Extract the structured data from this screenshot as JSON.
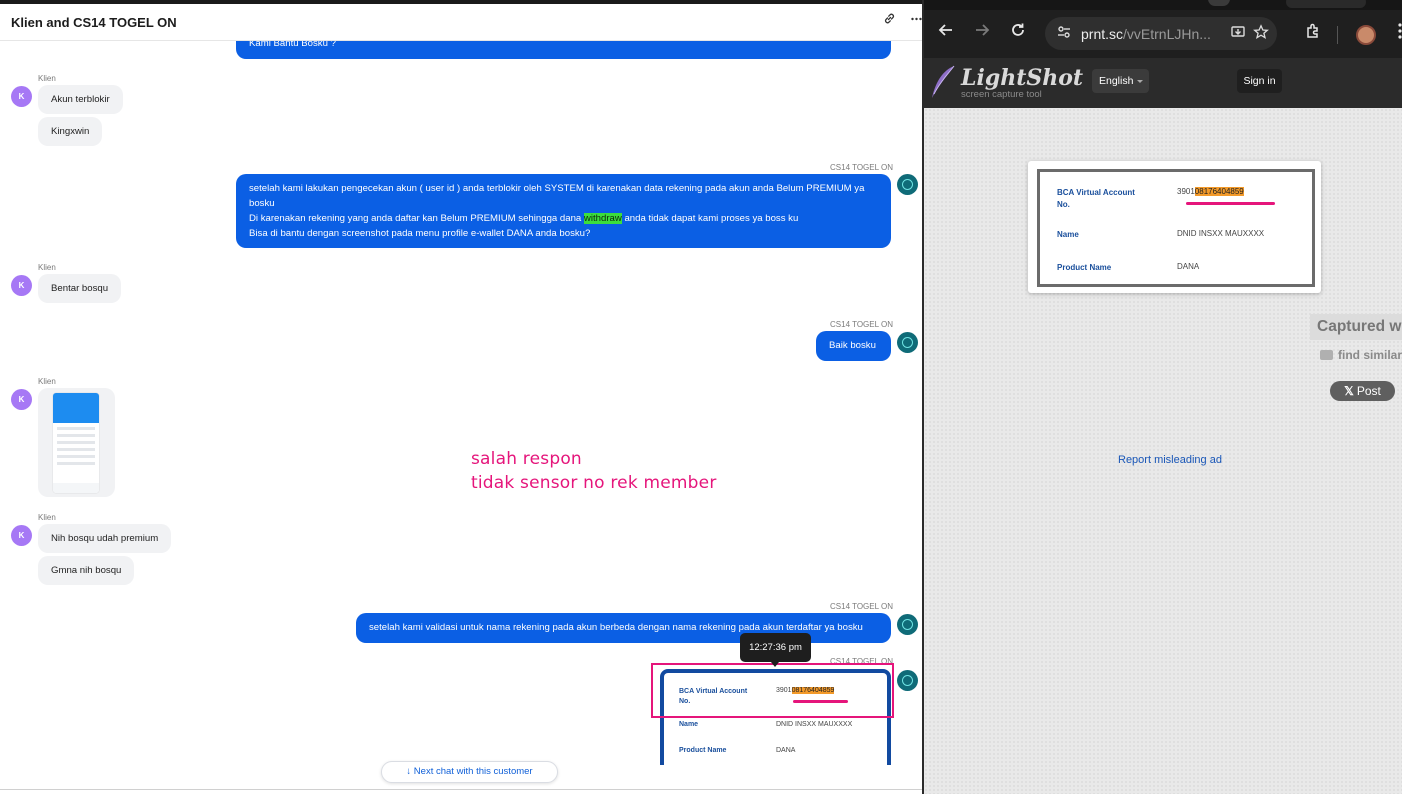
{
  "chat": {
    "title": "Klien and CS14 TOGEL ON",
    "top_bubble": "Kami Bantu Bosku ?",
    "client_name": "Klien",
    "client_initial": "K",
    "agent_name": "CS14 TOGEL ON",
    "msg_akun_terblokir": "Akun terblokir",
    "msg_kingxwin": "Kingxwin",
    "agent_msg1": {
      "line1": "setelah kami lakukan pengecekan akun ( user id ) anda terblokir oleh SYSTEM di karenakan data rekening pada akun anda Belum PREMIUM ya",
      "line2": "bosku",
      "line3a": "Di karenakan rekening yang anda daftar kan Belum PREMIUM sehingga dana ",
      "line3_highlight": "withdraw",
      "line3b": " anda tidak dapat kami proses ya boss ku",
      "line4": "Bisa di bantu dengan screenshot pada menu profile e-wallet DANA anda bosku?"
    },
    "msg_bentar": "Bentar bosqu",
    "agent_msg2": "Baik bosku",
    "msg_premium": "Nih bosqu udah premium",
    "msg_gmna": "Gmna nih bosqu",
    "agent_msg3": "setelah kami validasi untuk nama rekening pada akun berbeda dengan nama rekening pada akun terdaftar ya bosku",
    "tooltip_time": "12:27:36 pm",
    "annotation_line1": "salah respon",
    "annotation_line2": "tidak sensor no rek member",
    "card": {
      "va_label_1": "BCA Virtual Account",
      "va_label_2": "No.",
      "va_prefix": "3901",
      "va_number": "08176404859",
      "name_label": "Name",
      "name_value": "DNID INSXX MAUXXXX",
      "product_label": "Product Name",
      "product_value": "DANA"
    },
    "next_chat": "Next chat with this customer"
  },
  "browser": {
    "url_main": "prnt.sc",
    "url_rest": "/vvEtrnLJHn...",
    "lightshot_logo": "LightShot",
    "lightshot_tag": "screen capture tool",
    "language": "English",
    "sign_in": "Sign in",
    "captured": "Captured w",
    "find_similar": "find similar",
    "x_post": "Post",
    "report": "Report misleading ad"
  },
  "colors": {
    "bubble_blue": "#0b5fe4",
    "annotation_pink": "#e5157b",
    "highlight_green": "#3cde3c",
    "highlight_orange": "#f39a2a"
  }
}
